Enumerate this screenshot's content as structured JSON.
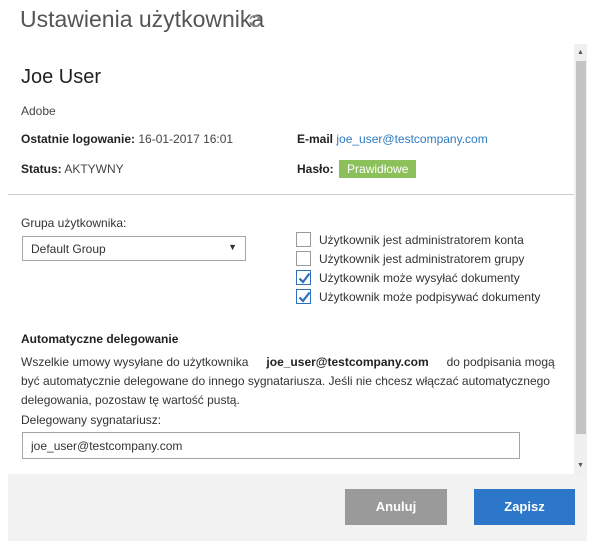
{
  "header": {
    "title": "Ustawienia użytkownika",
    "refresh_icon": "refresh-icon"
  },
  "user": {
    "name": "Joe User",
    "organization": "Adobe",
    "last_login_label": "Ostatnie logowanie:",
    "last_login_value": "16-01-2017 16:01",
    "email_label": "E-mail",
    "email_value": "joe_user@testcompany.com",
    "status_label": "Status:",
    "status_value": "AKTYWNY",
    "password_label": "Hasło:",
    "password_value": "Prawidłowe"
  },
  "group": {
    "label": "Grupa użytkownika:",
    "selected": "Default Group"
  },
  "permissions": [
    {
      "label": "Użytkownik jest administratorem konta",
      "checked": false
    },
    {
      "label": "Użytkownik jest administratorem grupy",
      "checked": false
    },
    {
      "label": "Użytkownik może wysyłać dokumenty",
      "checked": true
    },
    {
      "label": "Użytkownik może podpisywać dokumenty",
      "checked": true
    }
  ],
  "delegation": {
    "heading": "Automatyczne delegowanie",
    "text_before": "Wszelkie umowy wysyłane do użytkownika",
    "email": "joe_user@testcompany.com",
    "text_after": "do podpisania mogą być automatycznie delegowane do innego sygnatariusza. Jeśli nie chcesz włączać automatycznego delegowania, pozostaw tę wartość pustą.",
    "signer_label": "Delegowany sygnatariusz:",
    "signer_value": "joe_user@testcompany.com"
  },
  "footer": {
    "cancel_label": "Anuluj",
    "save_label": "Zapisz"
  },
  "colors": {
    "accent": "#2c77c9",
    "badge_green": "#8cc05b",
    "cancel_gray": "#9a9a9a"
  }
}
